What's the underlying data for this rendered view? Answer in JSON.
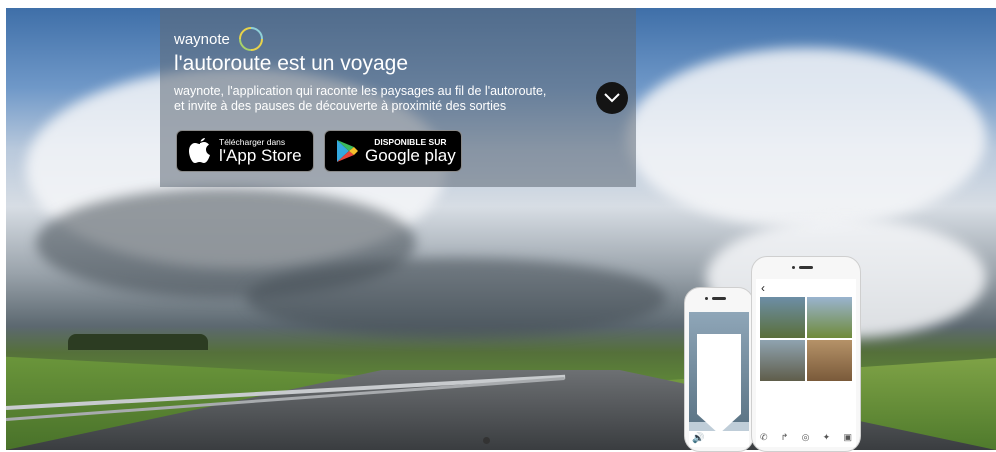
{
  "brand": {
    "name": "waynote"
  },
  "hero": {
    "title": "l'autoroute est un voyage",
    "description_line1": "waynote, l'application qui raconte les paysages au fil de l'autoroute,",
    "description_line2": "et invite à des pauses de découverte à proximité des sorties"
  },
  "stores": {
    "appstore": {
      "small": "Télécharger dans",
      "big": "l'App Store"
    },
    "googleplay": {
      "small": "DISPONIBLE SUR",
      "big": "Google play"
    }
  },
  "colors": {
    "panel_bg": "#5f6976",
    "button_bg": "#000000",
    "text": "#ffffff"
  },
  "icons": {
    "scroll_down": "chevron-down-icon",
    "apple": "apple-icon",
    "google_play": "google-play-icon",
    "logo_mark": "waynote-logo-icon"
  }
}
